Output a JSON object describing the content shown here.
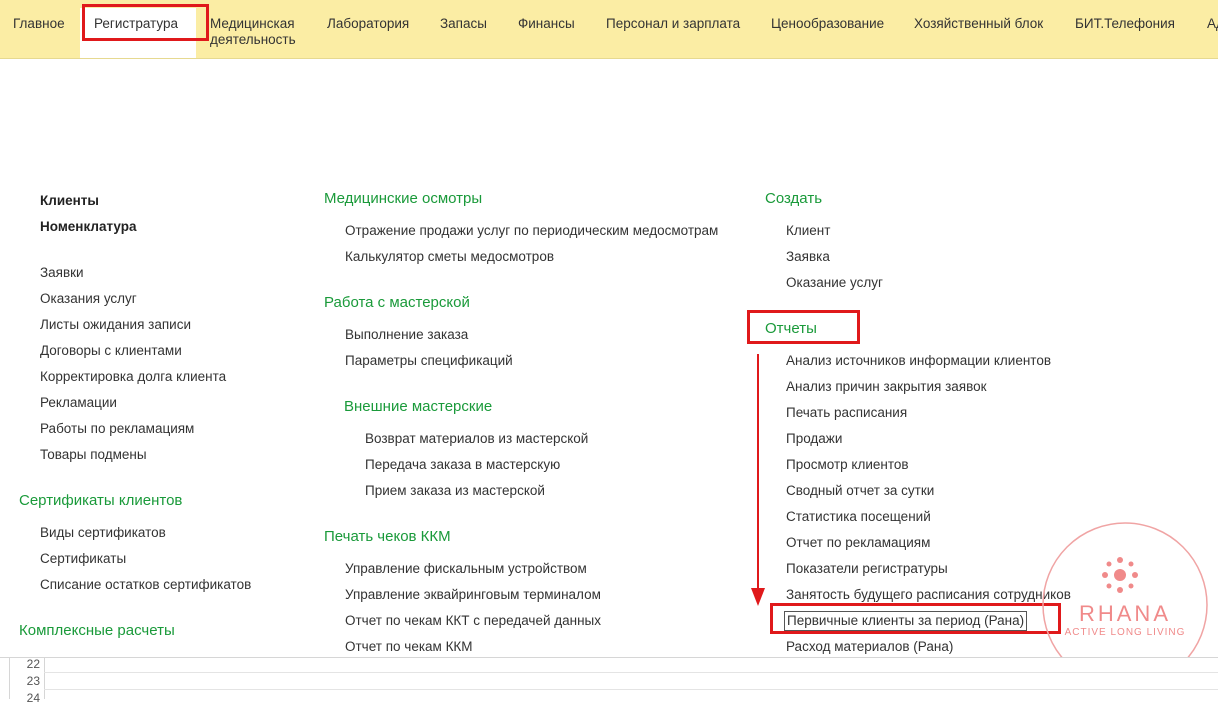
{
  "topnav": {
    "tabs": [
      "Главное",
      "Регистратура",
      "Медицинская\nдеятельность",
      "Лаборатория",
      "Запасы",
      "Финансы",
      "Персонал и зарплата",
      "Ценообразование",
      "Хозяйственный блок",
      "БИТ.Телефония",
      "Ад"
    ]
  },
  "col1": {
    "top_items": [
      "Клиенты",
      "Номенклатура"
    ],
    "items": [
      "Заявки",
      "Оказания услуг",
      "Листы ожидания записи",
      "Договоры с клиентами",
      "Корректировка долга клиента",
      "Рекламации",
      "Работы по рекламациям",
      "Товары подмены"
    ],
    "cert_heading": "Сертификаты клиентов",
    "cert_items": [
      "Виды сертификатов",
      "Сертификаты",
      "Списание остатков сертификатов"
    ],
    "complex_heading": "Комплексные расчеты"
  },
  "col2": {
    "med_heading": "Медицинские осмотры",
    "med_items": [
      "Отражение продажи услуг по периодическим медосмотрам",
      "Калькулятор сметы медосмотров"
    ],
    "workshop_heading": "Работа с мастерской",
    "workshop_items": [
      "Выполнение заказа",
      "Параметры спецификаций"
    ],
    "ext_heading": "Внешние мастерские",
    "ext_items": [
      "Возврат материалов из мастерской",
      "Передача заказа в мастерскую",
      "Прием заказа из мастерской"
    ],
    "kkm_heading": "Печать чеков ККМ",
    "kkm_items": [
      "Управление фискальным устройством",
      "Управление эквайринговым терминалом",
      "Отчет по чекам ККТ с передачей данных",
      "Отчет по чекам ККМ"
    ]
  },
  "col3": {
    "create_heading": "Создать",
    "create_items": [
      "Клиент",
      "Заявка",
      "Оказание услуг"
    ],
    "reports_heading": "Отчеты",
    "report_items": [
      "Анализ источников информации клиентов",
      "Анализ причин закрытия заявок",
      "Печать расписания",
      "Продажи",
      "Просмотр клиентов",
      "Сводный отчет за сутки",
      "Статистика посещений",
      "Отчет по рекламациям",
      "Показатели регистратуры",
      "Занятость будущего расписания сотрудников",
      "Первичные клиенты за период (Рана)",
      "Расход материалов (Рана)"
    ]
  },
  "rows": [
    "22",
    "23",
    "24"
  ],
  "watermark": {
    "brand": "RHANA",
    "tagline": "ACTIVE LONG LIVING"
  },
  "colors": {
    "accent_red": "#e0191b",
    "heading_green": "#1a9a3a",
    "nav_bg": "#fbeda4"
  }
}
